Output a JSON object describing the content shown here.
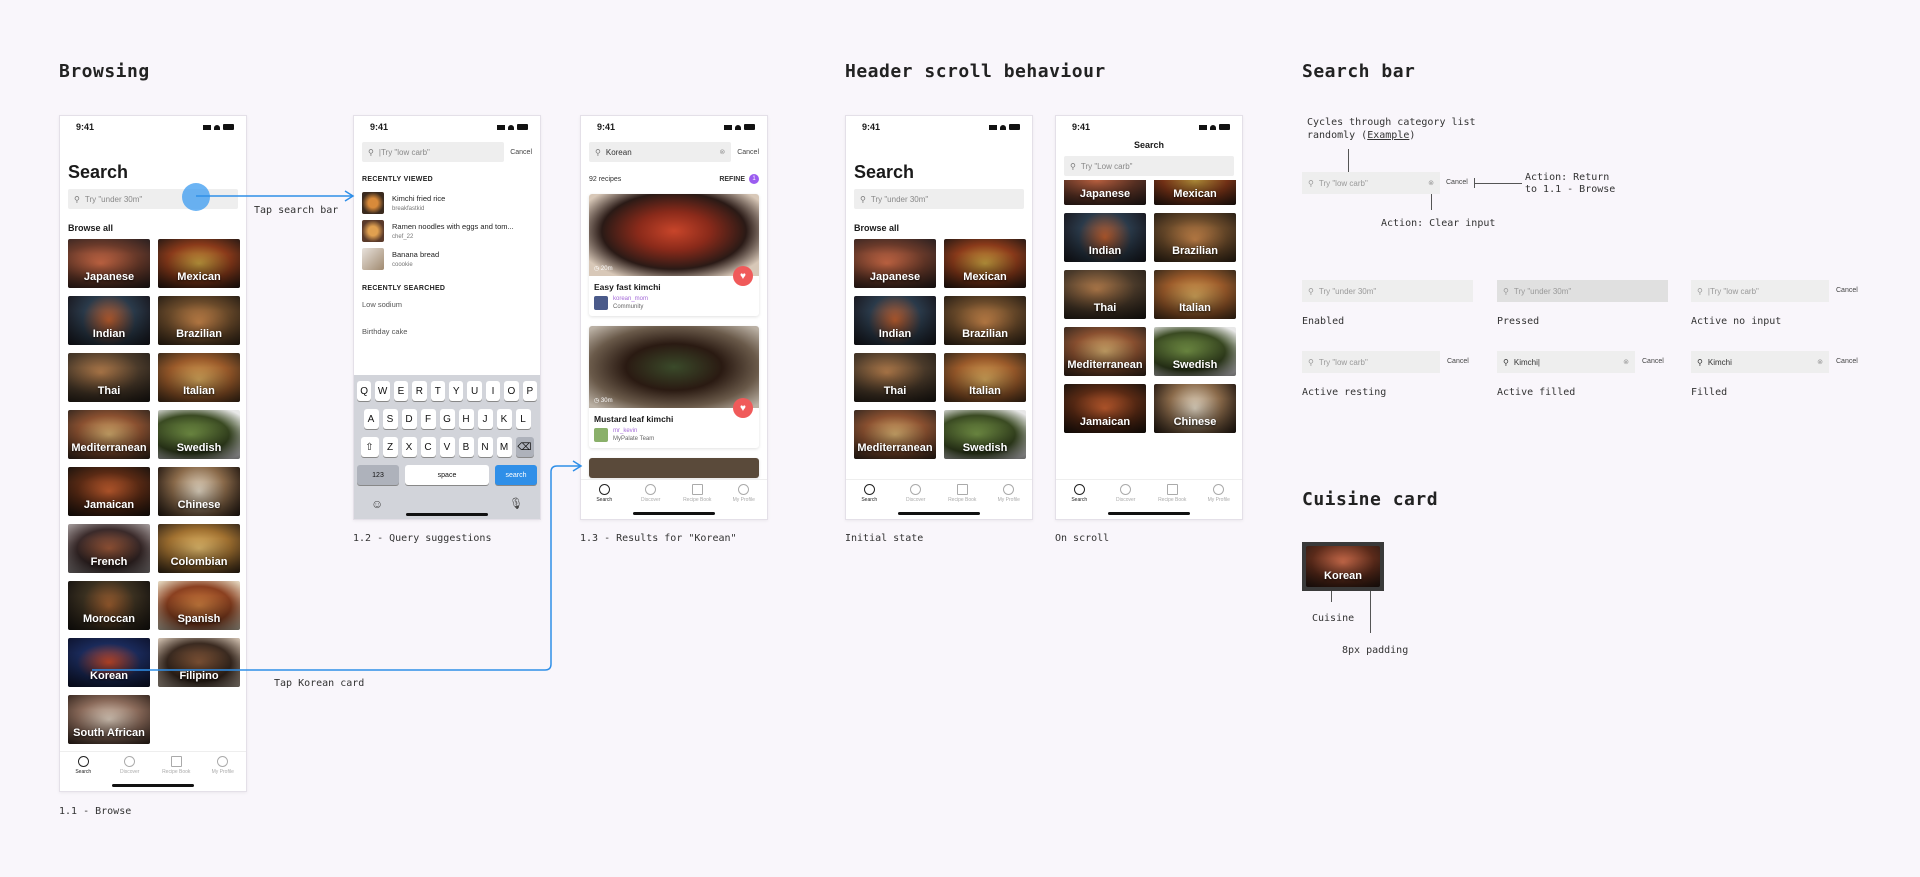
{
  "sections": {
    "browsing": "Browsing",
    "header_scroll": "Header scroll behaviour",
    "search_bar": "Search bar",
    "cuisine_card": "Cuisine card"
  },
  "status": {
    "time": "9:41"
  },
  "tabs": [
    "Search",
    "Discover",
    "Recipe Book",
    "My Profile"
  ],
  "screen_browse": {
    "title": "Search",
    "placeholder": "Try \"under 30m\"",
    "browse_all": "Browse all",
    "cuisines": [
      "Japanese",
      "Mexican",
      "Indian",
      "Brazilian",
      "Thai",
      "Italian",
      "Mediterranean",
      "Swedish",
      "Jamaican",
      "Chinese",
      "French",
      "Colombian",
      "Moroccan",
      "Spanish",
      "Korean",
      "Filipino",
      "South African"
    ],
    "caption": "1.1 - Browse"
  },
  "screen_query": {
    "input": "|Try \"low carb\"",
    "cancel": "Cancel",
    "recent_viewed_label": "RECENTLY VIEWED",
    "recent_viewed": [
      {
        "title": "Kimchi fried rice",
        "user": "breakfastkid"
      },
      {
        "title": "Ramen noodles with eggs and tom...",
        "user": "chef_22"
      },
      {
        "title": "Banana bread",
        "user": "coookie"
      }
    ],
    "recent_searched_label": "RECENTLY SEARCHED",
    "recent_searched": [
      "Low sodium",
      "Birthday cake"
    ],
    "keys_row1": [
      "Q",
      "W",
      "E",
      "R",
      "T",
      "Y",
      "U",
      "I",
      "O",
      "P"
    ],
    "keys_row2": [
      "A",
      "S",
      "D",
      "F",
      "G",
      "H",
      "J",
      "K",
      "L"
    ],
    "keys_row3": [
      "Z",
      "X",
      "C",
      "V",
      "B",
      "N",
      "M"
    ],
    "key_123": "123",
    "key_space": "space",
    "key_search": "search",
    "caption": "1.2 - Query suggestions"
  },
  "screen_results": {
    "input": "Korean",
    "cancel": "Cancel",
    "count": "92 recipes",
    "refine": "REFINE",
    "refine_count": "1",
    "recipes": [
      {
        "time": "20m",
        "title": "Easy fast kimchi",
        "user": "korean_mom",
        "group": "Community"
      },
      {
        "time": "30m",
        "title": "Mustard leaf kimchi",
        "user": "mr_kevin",
        "group": "MyPalate Team"
      }
    ],
    "caption": "1.3 - Results for \"Korean\""
  },
  "screen_initial": {
    "title": "Search",
    "placeholder": "Try \"under 30m\"",
    "browse_all": "Browse all",
    "cuisines": [
      "Japanese",
      "Mexican",
      "Indian",
      "Brazilian",
      "Thai",
      "Italian",
      "Mediterranean",
      "Swedish"
    ],
    "caption": "Initial state"
  },
  "screen_scroll": {
    "title": "Search",
    "placeholder": "Try \"Low carb\"",
    "cuisines": [
      "Japanese",
      "Mexican",
      "Indian",
      "Brazilian",
      "Thai",
      "Italian",
      "Mediterranean",
      "Swedish",
      "Jamaican",
      "Chinese"
    ],
    "caption": "On scroll"
  },
  "annotations": {
    "tap_search": "Tap search bar",
    "tap_korean": "Tap Korean card",
    "cycles_line1": "Cycles through category list",
    "cycles_line2": "randomly (",
    "example": "Example",
    "cycles_close": ")",
    "action_return1": "Action: Return",
    "action_return2": "to 1.1 - Browse",
    "action_clear": "Action: Clear input",
    "cuisine": "Cuisine",
    "padding": "8px padding"
  },
  "search_states": {
    "anatomy": {
      "placeholder": "Try \"low carb\"",
      "cancel": "Cancel"
    },
    "enabled": {
      "text": "Try \"under 30m\"",
      "label": "Enabled"
    },
    "pressed": {
      "text": "Try \"under 30m\"",
      "label": "Pressed"
    },
    "active_no_input": {
      "text": "|Try \"low carb\"",
      "cancel": "Cancel",
      "label": "Active no input"
    },
    "active_resting": {
      "text": "Try \"low carb\"",
      "cancel": "Cancel",
      "label": "Active resting"
    },
    "active_filled": {
      "text": "Kimchi|",
      "cancel": "Cancel",
      "label": "Active filled"
    },
    "filled": {
      "text": "Kimchi",
      "cancel": "Cancel",
      "label": "Filled"
    }
  },
  "cuisine_demo": {
    "name": "Korean"
  },
  "colors": {
    "accent": "#2f8fe8",
    "heart": "#f05a5a",
    "refine": "#9b5cf0",
    "username": "#a46ad8"
  }
}
